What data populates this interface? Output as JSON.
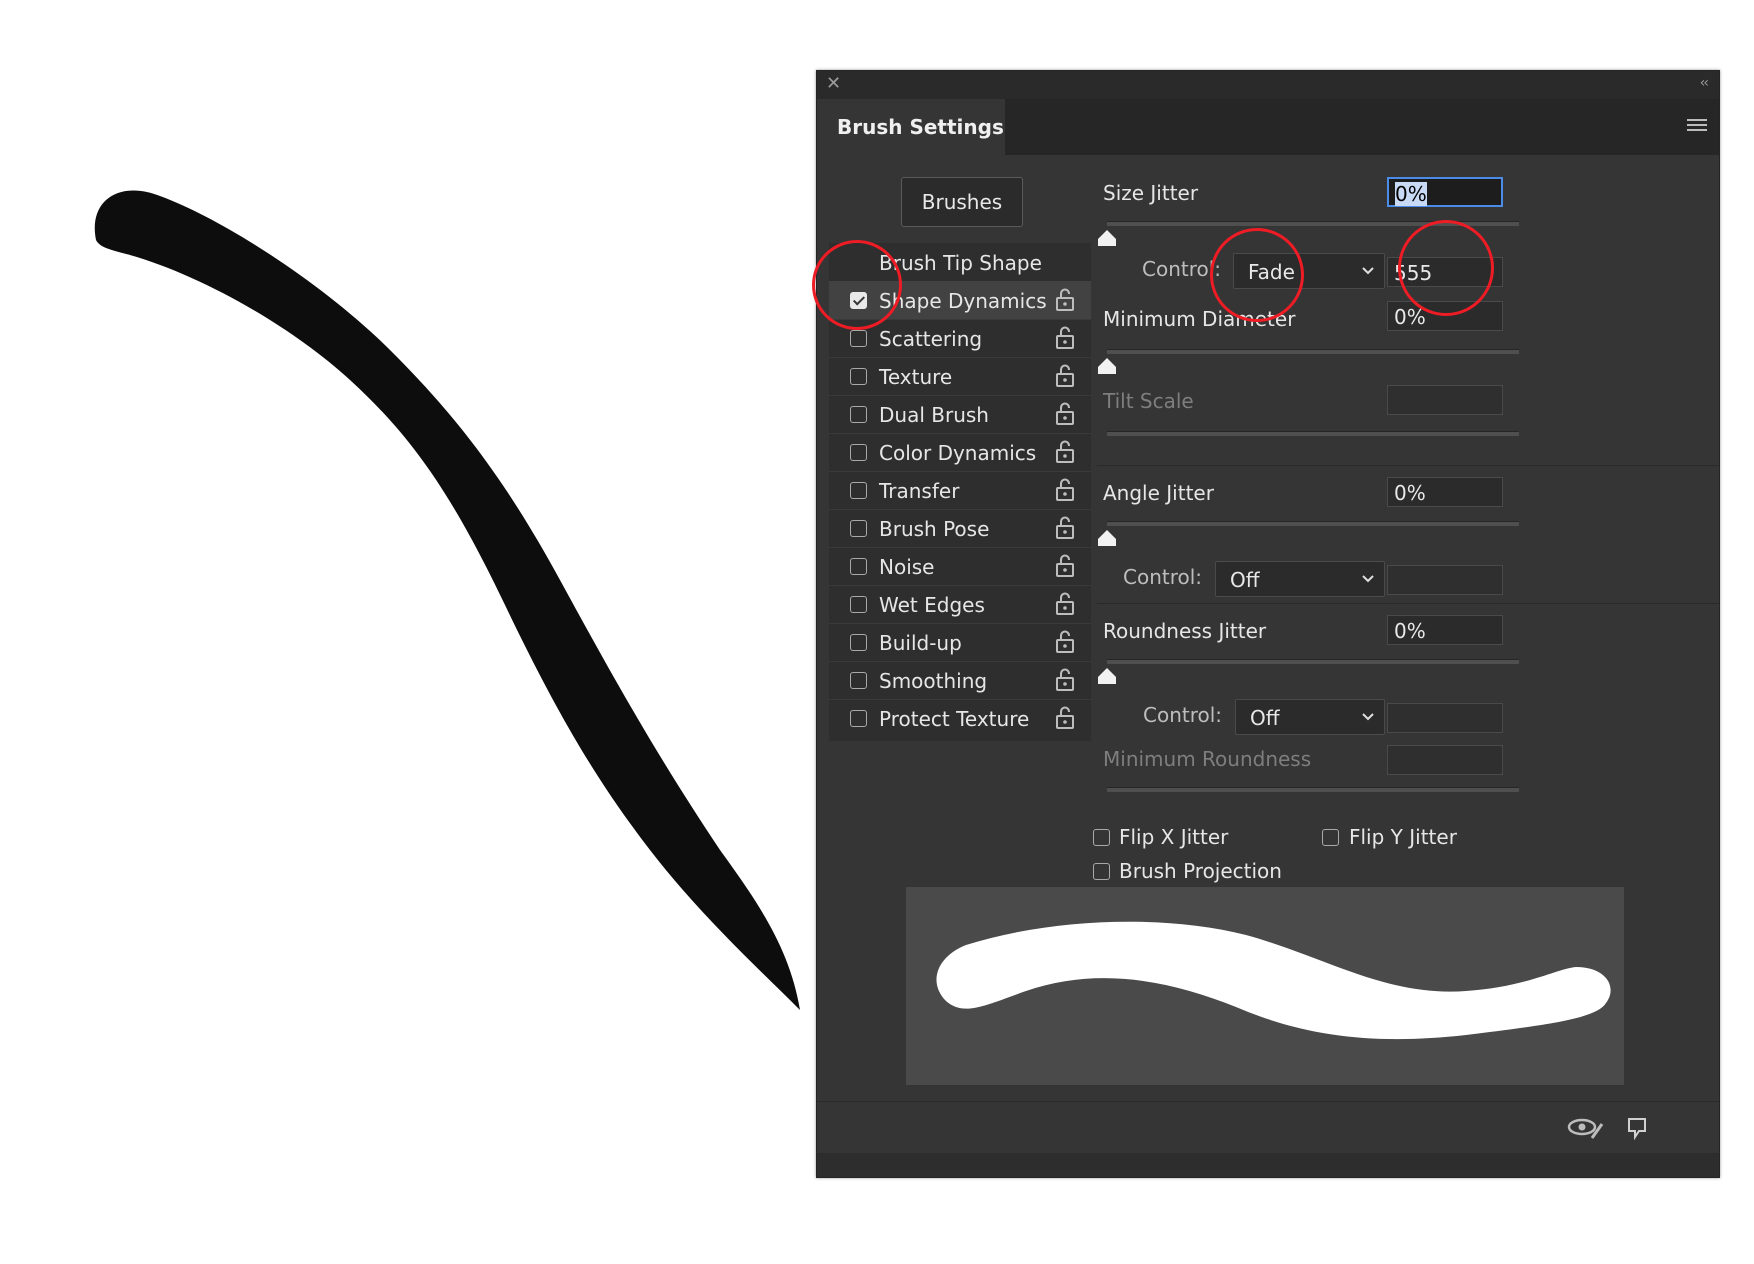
{
  "panel": {
    "tab_title": "Brush Settings",
    "brushes_button": "Brushes",
    "brush_tip_shape": "Brush Tip Shape",
    "list_items": [
      {
        "label": "Shape Dynamics",
        "checked": true
      },
      {
        "label": "Scattering",
        "checked": false
      },
      {
        "label": "Texture",
        "checked": false
      },
      {
        "label": "Dual Brush",
        "checked": false
      },
      {
        "label": "Color Dynamics",
        "checked": false
      },
      {
        "label": "Transfer",
        "checked": false
      },
      {
        "label": "Brush Pose",
        "checked": false
      },
      {
        "label": "Noise",
        "checked": false
      },
      {
        "label": "Wet Edges",
        "checked": false
      },
      {
        "label": "Build-up",
        "checked": false
      },
      {
        "label": "Smoothing",
        "checked": false
      },
      {
        "label": "Protect Texture",
        "checked": false
      }
    ]
  },
  "settings": {
    "size_jitter": {
      "label": "Size Jitter",
      "value": "0%"
    },
    "size_control": {
      "label": "Control:",
      "selected": "Fade",
      "value": "555"
    },
    "minimum_diameter": {
      "label": "Minimum Diameter",
      "value": "0%"
    },
    "tilt_scale": {
      "label": "Tilt Scale"
    },
    "angle_jitter": {
      "label": "Angle Jitter",
      "value": "0%"
    },
    "angle_control": {
      "label": "Control:",
      "selected": "Off"
    },
    "roundness_jitter": {
      "label": "Roundness Jitter",
      "value": "0%"
    },
    "roundness_control": {
      "label": "Control:",
      "selected": "Off"
    },
    "minimum_roundness": {
      "label": "Minimum Roundness"
    },
    "flip_x": "Flip X Jitter",
    "flip_y": "Flip Y Jitter",
    "brush_projection": "Brush Projection"
  },
  "colors": {
    "panel_bg": "#353535",
    "annotation": "#ee1c25",
    "focus": "#4b8ce9"
  }
}
